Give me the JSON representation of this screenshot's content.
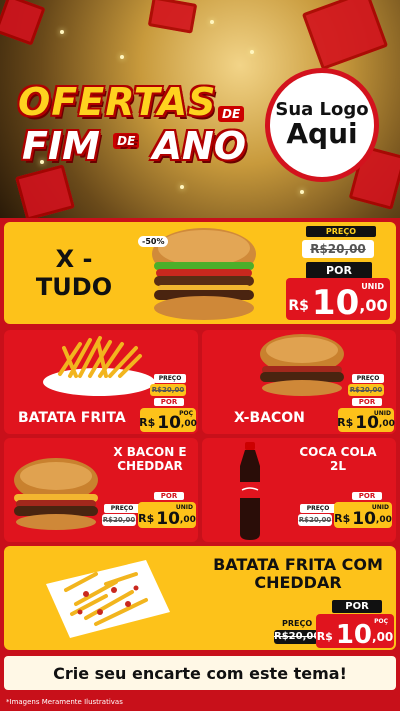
{
  "header": {
    "title_line1": "OFERTAS",
    "title_de": "DE",
    "title_line2_a": "FIM",
    "title_de2": "DE",
    "title_line2_b": "ANO",
    "logo_line1": "Sua Logo",
    "logo_line2": "Aqui"
  },
  "featured": {
    "name_line1": "X -",
    "name_line2": "TUDO",
    "discount": "-50%",
    "preco_label": "PREÇO",
    "old_price": "R$20,00",
    "por_label": "POR",
    "currency": "R$",
    "price_int": "10",
    "price_cents": ",00",
    "unit": "UNID"
  },
  "products": [
    {
      "name": "BATATA FRITA",
      "preco_label": "PREÇO",
      "old_price": "R$20,00",
      "por_label": "POR",
      "currency": "R$",
      "price_int": "10",
      "price_cents": ",00",
      "unit": "POÇ"
    },
    {
      "name": "X-BACON",
      "preco_label": "PREÇO",
      "old_price": "R$20,00",
      "por_label": "POR",
      "currency": "R$",
      "price_int": "10",
      "price_cents": ",00",
      "unit": "UNID"
    },
    {
      "name_line1": "X BACON E",
      "name_line2": "CHEDDAR",
      "preco_label": "PREÇO",
      "old_price": "R$20,00",
      "por_label": "POR",
      "currency": "R$",
      "price_int": "10",
      "price_cents": ",00",
      "unit": "UNID"
    },
    {
      "name_line1": "COCA COLA",
      "name_line2": "2L",
      "preco_label": "PREÇO",
      "old_price": "R$20,00",
      "por_label": "POR",
      "currency": "R$",
      "price_int": "10",
      "price_cents": ",00",
      "unit": "UNID"
    }
  ],
  "bottom_product": {
    "name_line1": "BATATA FRITA COM",
    "name_line2": "CHEDDAR",
    "preco_label": "PREÇO",
    "old_price": "R$20,00",
    "por_label": "POR",
    "currency": "R$",
    "price_int": "10",
    "price_cents": ",00",
    "unit": "POÇ"
  },
  "footer": {
    "cta": "Crie seu encarte com este tema!",
    "disclaimer": "*Imagens Meramente Ilustrativas"
  },
  "colors": {
    "red": "#e0141e",
    "yellow": "#fdc21a",
    "dark": "#111111"
  }
}
